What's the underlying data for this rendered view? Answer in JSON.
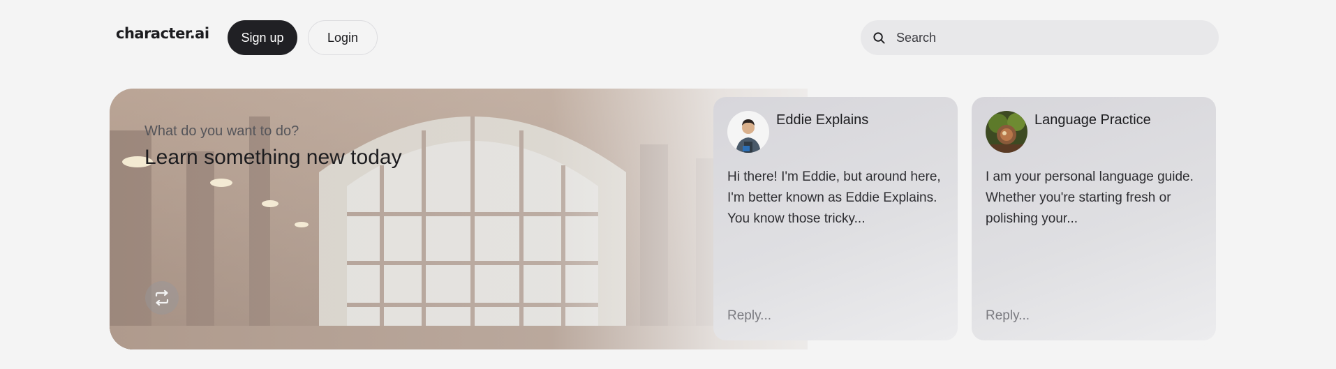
{
  "header": {
    "logo": "character.ai",
    "signup_label": "Sign up",
    "login_label": "Login",
    "search_placeholder": "Search"
  },
  "hero": {
    "subtitle": "What do you want to do?",
    "title": "Learn something new today",
    "shuffle_icon": "shuffle-icon"
  },
  "cards": [
    {
      "name": "Eddie Explains",
      "description": "Hi there! I'm Eddie, but around here, I'm better known as Eddie Explains. You know those tricky...",
      "reply_placeholder": "Reply..."
    },
    {
      "name": "Language Practice",
      "description": "I am your personal language guide. Whether you're starting fresh or polishing your...",
      "reply_placeholder": "Reply..."
    }
  ],
  "colors": {
    "background": "#f4f4f4",
    "primary_button": "#202024",
    "search_bg": "#e8e8ea",
    "card_bg": "#dcdbe0"
  }
}
